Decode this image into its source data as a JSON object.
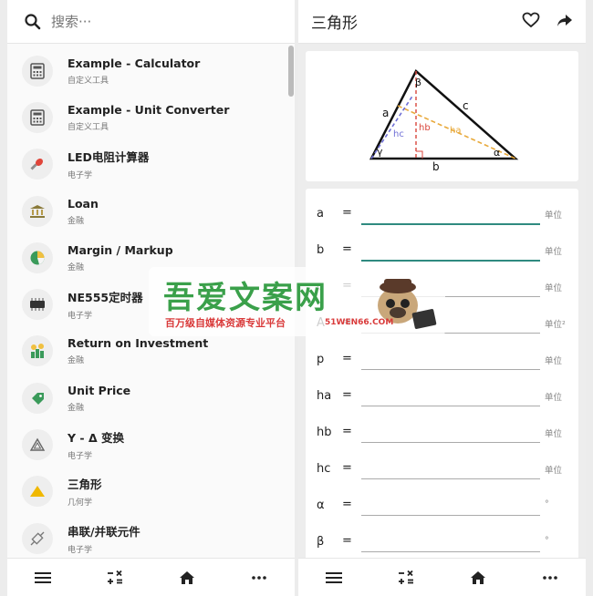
{
  "search": {
    "placeholder": "搜索···"
  },
  "list": [
    {
      "title": "Example - Calculator",
      "category": "自定义工具",
      "icon": "calculator-icon"
    },
    {
      "title": "Example - Unit Converter",
      "category": "自定义工具",
      "icon": "calculator-icon"
    },
    {
      "title": "LED电阻计算器",
      "category": "电子学",
      "icon": "led-icon"
    },
    {
      "title": "Loan",
      "category": "金融",
      "icon": "bank-icon"
    },
    {
      "title": "Margin / Markup",
      "category": "金融",
      "icon": "pie-chart-icon"
    },
    {
      "title": "NE555定时器",
      "category": "电子学",
      "icon": "chip-icon"
    },
    {
      "title": "Return on Investment",
      "category": "金融",
      "icon": "money-bag-icon"
    },
    {
      "title": "Unit Price",
      "category": "金融",
      "icon": "price-tag-icon"
    },
    {
      "title": "Y - Δ 变换",
      "category": "电子学",
      "icon": "triangle-outline-icon"
    },
    {
      "title": "三角形",
      "category": "几何学",
      "icon": "triangle-filled-icon"
    },
    {
      "title": "串联/并联元件",
      "category": "电子学",
      "icon": "component-icon"
    }
  ],
  "detail": {
    "title": "三角形",
    "diagram_labels": {
      "a": "a",
      "b": "b",
      "c": "c",
      "alpha": "α",
      "beta": "β",
      "gamma": "γ",
      "ha": "ha",
      "hb": "hb",
      "hc": "hc"
    },
    "fields": [
      {
        "label": "a",
        "eq": "=",
        "value": "",
        "unit": "单位",
        "active": true
      },
      {
        "label": "b",
        "eq": "=",
        "value": "",
        "unit": "单位",
        "active": true
      },
      {
        "label": "c",
        "eq": "=",
        "value": "",
        "unit": "单位",
        "active": false
      },
      {
        "label": "A",
        "eq": "=",
        "value": "",
        "unit": "单位²",
        "active": false
      },
      {
        "label": "p",
        "eq": "=",
        "value": "",
        "unit": "单位",
        "active": false
      },
      {
        "label": "ha",
        "eq": "=",
        "value": "",
        "unit": "单位",
        "active": false
      },
      {
        "label": "hb",
        "eq": "=",
        "value": "",
        "unit": "单位",
        "active": false
      },
      {
        "label": "hc",
        "eq": "=",
        "value": "",
        "unit": "单位",
        "active": false
      },
      {
        "label": "α",
        "eq": "=",
        "value": "",
        "unit": "°",
        "active": false
      },
      {
        "label": "β",
        "eq": "=",
        "value": "",
        "unit": "°",
        "active": false
      }
    ]
  },
  "watermark": {
    "title": "吾爱文案网",
    "subtitle": "百万级自媒体资源专业平台",
    "url": "51WEN66.COM"
  },
  "colors": {
    "accent": "#2f8a80",
    "ha": "#e8a93a",
    "hb": "#d9463c",
    "hc": "#6f6fd6",
    "watermark_green": "#3aa04a",
    "watermark_red": "#d93a3a"
  }
}
